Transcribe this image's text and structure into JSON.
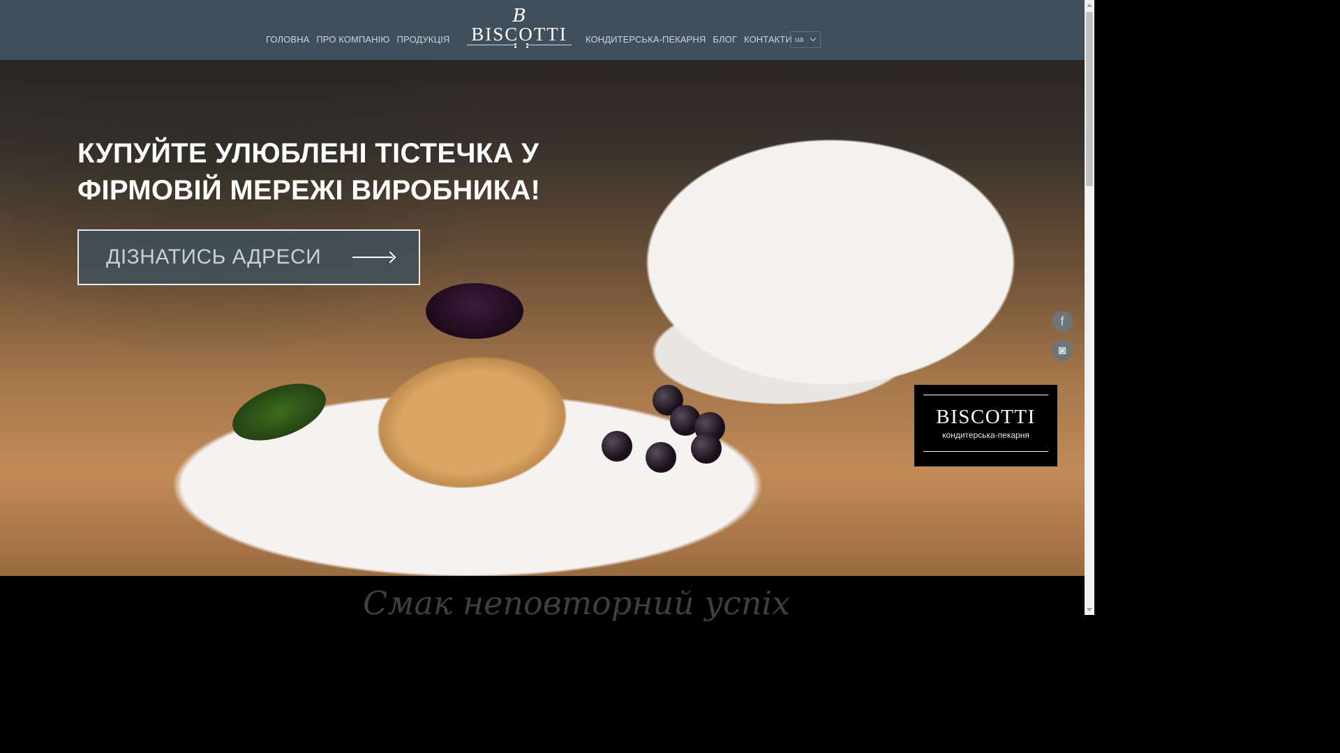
{
  "header": {
    "nav_left": [
      "ГОЛОВНА",
      "ПРО КОМПАНІЮ",
      "ПРОДУКЦІЯ"
    ],
    "nav_right": [
      "КОНДИТЕРСЬКА-ПЕКАРНЯ",
      "БЛОГ",
      "КОНТАКТИ"
    ],
    "logo": {
      "monogram": "B",
      "wordmark": "BISCOTTI"
    },
    "language": "ua"
  },
  "hero": {
    "headline": "КУПУЙТЕ УЛЮБЛЕНІ ТІСТЕЧКА У ФІРМОВІЙ МЕРЕЖІ ВИРОБНИКА!",
    "cta_label": "ДІЗНАТИСЬ АДРЕСИ",
    "social": [
      {
        "icon": "facebook-icon",
        "glyph": "f"
      },
      {
        "icon": "instagram-icon",
        "glyph": "◙"
      }
    ],
    "badge": {
      "wordmark": "BISCOTTI",
      "subtitle": "кондитерська-пекарня"
    }
  },
  "footer_tagline": "Смак неповторний успіх",
  "colors": {
    "header_bg": "#3f505c",
    "cta_bg": "#3f505c",
    "badge_bg": "#000000"
  }
}
